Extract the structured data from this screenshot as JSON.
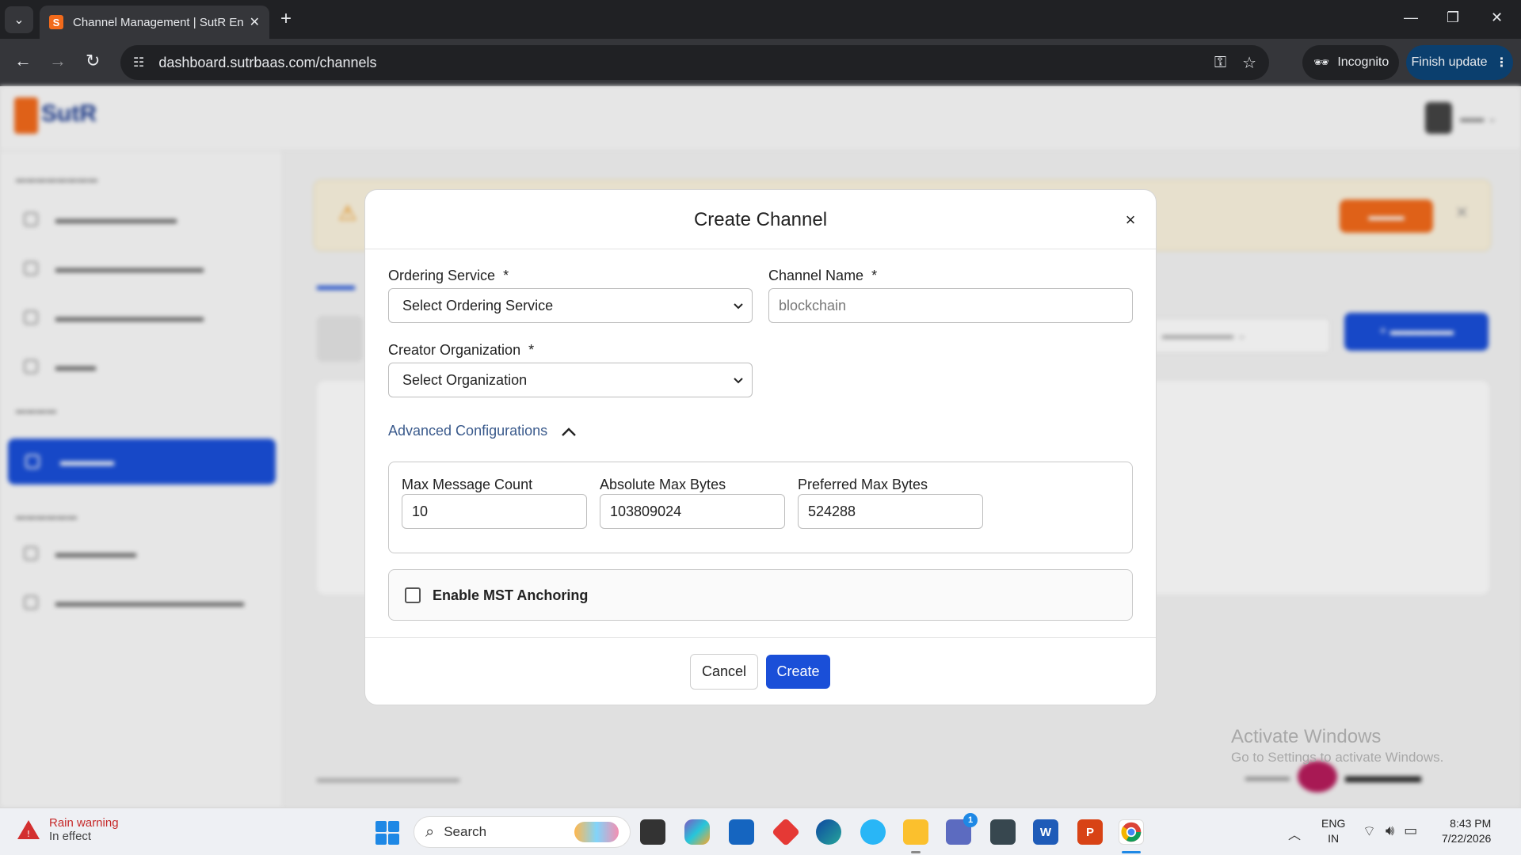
{
  "browser": {
    "tab_title": "Channel Management | SutR En",
    "url": "dashboard.sutrbaas.com/channels",
    "incognito_label": "Incognito",
    "finish_update_label": "Finish update"
  },
  "app": {
    "logo_text": "SutR"
  },
  "modal": {
    "title": "Create Channel",
    "close_glyph": "×",
    "ordering_service": {
      "label": "Ordering Service",
      "required_mark": "*",
      "selected": "Select Ordering Service"
    },
    "channel_name": {
      "label": "Channel Name",
      "required_mark": "*",
      "placeholder": "blockchain",
      "value": ""
    },
    "creator_org": {
      "label": "Creator Organization",
      "required_mark": "*",
      "selected": "Select Organization"
    },
    "advanced": {
      "toggle_label": "Advanced Configurations",
      "expanded": true,
      "max_message_count": {
        "label": "Max Message Count",
        "value": "10"
      },
      "absolute_max_bytes": {
        "label": "Absolute Max Bytes",
        "value": "103809024"
      },
      "preferred_max_bytes": {
        "label": "Preferred Max Bytes",
        "value": "524288"
      }
    },
    "mst_anchoring": {
      "label": "Enable MST Anchoring",
      "checked": false
    },
    "cancel_label": "Cancel",
    "create_label": "Create"
  },
  "watermark": {
    "title": "Activate Windows",
    "subtitle": "Go to Settings to activate Windows."
  },
  "taskbar": {
    "weather_title": "Rain warning",
    "weather_sub": "In effect",
    "search_label": "Search",
    "lang_top": "ENG",
    "lang_bottom": "IN",
    "time": "8:43 PM",
    "date": "7/22/2026",
    "teams_badge": "1"
  },
  "colors": {
    "primary": "#1a4fd8",
    "brand_orange": "#f26a1b",
    "link": "#3a5a8c"
  }
}
